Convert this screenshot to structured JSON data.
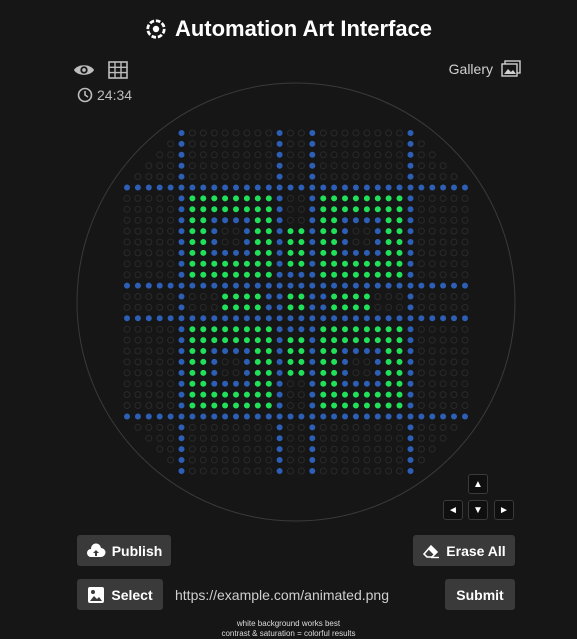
{
  "app": {
    "title": "Automation Art Interface",
    "timer": "24:34",
    "gallery_label": "Gallery"
  },
  "board": {
    "description_colors": {
      "off": "#2a2a2a",
      "green": "#21e05a",
      "blue": "#2c5fb5",
      "ring": "#3a3a3a"
    },
    "grid_size": 32
  },
  "controls": {
    "up": "▲",
    "left": "◄",
    "down": "▼",
    "right": "►"
  },
  "actions": {
    "publish_label": "Publish",
    "erase_label": "Erase All",
    "select_label": "Select",
    "url_value": "https://example.com/animated.png",
    "submit_label": "Submit"
  },
  "hints": {
    "line1": "white background works best",
    "line2": "contrast & saturation = colorful results"
  },
  "icons": {
    "title": "gear-flower-icon",
    "view": "eye-icon",
    "grid": "grid-icon",
    "clock": "clock-icon",
    "gallery": "gallery-icon",
    "publish": "cloud-upload-icon",
    "erase": "eraser-icon",
    "select": "image-icon"
  }
}
